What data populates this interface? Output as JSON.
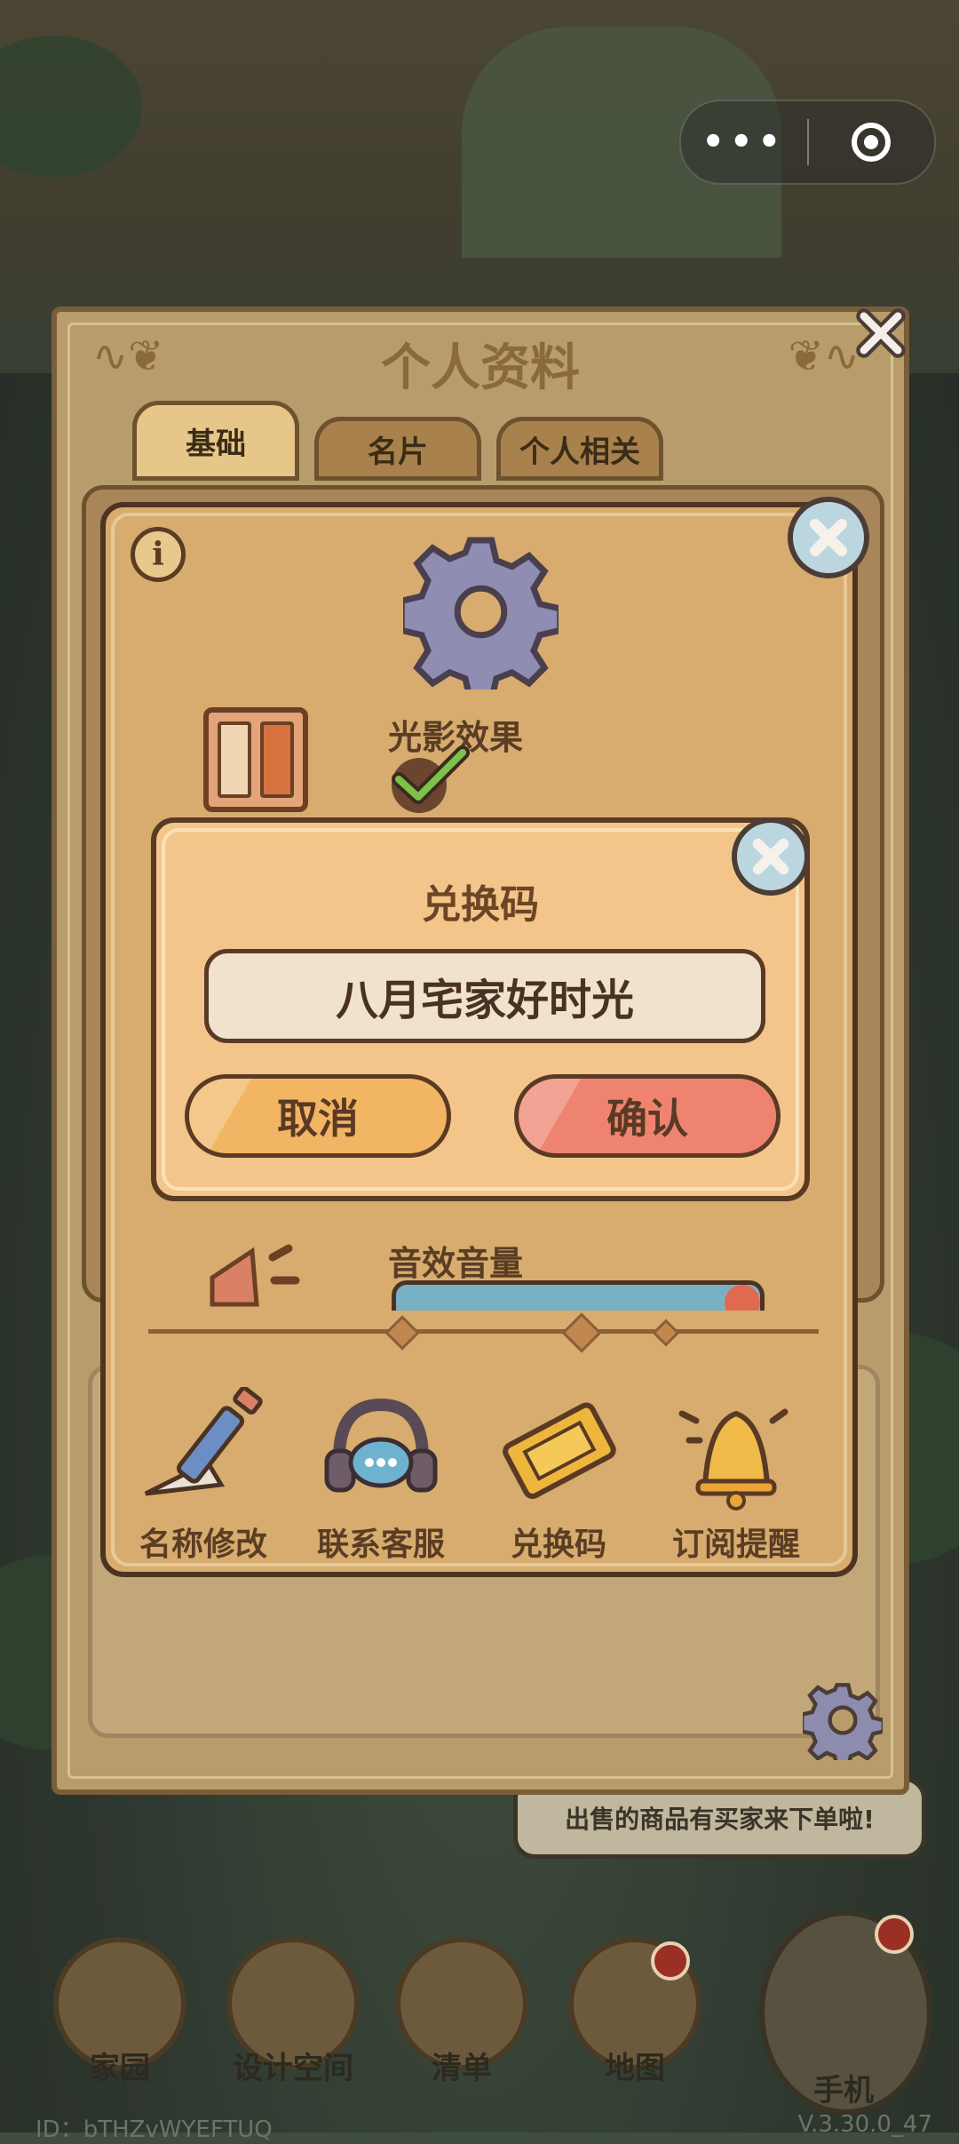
{
  "capsule": {
    "more_icon": "more-dots-icon",
    "close_icon": "target-icon"
  },
  "profile": {
    "title": "个人资料",
    "tabs": [
      {
        "label": "基础",
        "active": true
      },
      {
        "label": "名片",
        "active": false
      },
      {
        "label": "个人相关",
        "active": false
      }
    ]
  },
  "settings": {
    "light_shadow_label": "光影效果",
    "light_shadow_enabled": true,
    "sound_volume_label": "音效音量",
    "sound_volume_level": 0.95,
    "actions": [
      {
        "label": "名称修改",
        "icon": "pencil-icon"
      },
      {
        "label": "联系客服",
        "icon": "headset-icon"
      },
      {
        "label": "兑换码",
        "icon": "ticket-icon"
      },
      {
        "label": "订阅提醒",
        "icon": "bell-icon"
      }
    ]
  },
  "redeem": {
    "title": "兑换码",
    "input_value": "八月宅家好时光",
    "cancel_label": "取消",
    "confirm_label": "确认"
  },
  "bubble": {
    "text": "出售的商品有买家来下单啦!"
  },
  "bottom_nav": [
    {
      "label": "家园"
    },
    {
      "label": "设计空间"
    },
    {
      "label": "清单"
    },
    {
      "label": "地图"
    },
    {
      "label": "手机"
    }
  ],
  "footer": {
    "id_text": "ID：bTHZvWYEFTUQ",
    "version": "V.3.30.0_47"
  },
  "colors": {
    "panel": "#d7ac6e",
    "dialog": "#f3c58a",
    "cancel": "#f1b563",
    "confirm": "#ee8470",
    "border": "#5a3a24"
  }
}
